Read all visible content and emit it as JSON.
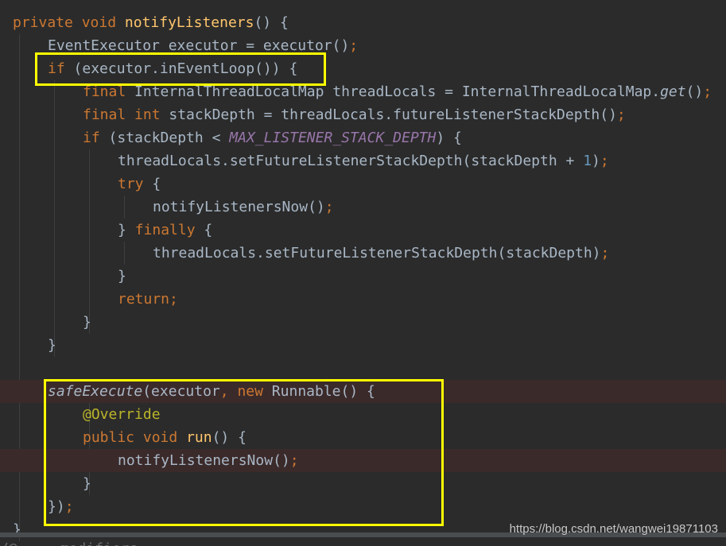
{
  "colors": {
    "background": "#2b2b2b",
    "keyword": "#cc7832",
    "method_declaration": "#ffc66d",
    "default_text": "#a9b7c6",
    "constant": "#9876aa",
    "number": "#6897bb",
    "annotation": "#bbb529",
    "highlight_box": "#ffff00",
    "error_line": "#3b2a2a"
  },
  "code_lines": [
    {
      "indent": 0,
      "tokens": [
        [
          "kw",
          "private"
        ],
        [
          "t",
          " "
        ],
        [
          "kw",
          "void"
        ],
        [
          "t",
          " "
        ],
        [
          "fn",
          "notifyListeners"
        ],
        [
          "t",
          "() {"
        ]
      ]
    },
    {
      "indent": 1,
      "tokens": [
        [
          "t",
          "EventExecutor executor = executor()"
        ],
        [
          "kw",
          ";"
        ]
      ]
    },
    {
      "indent": 1,
      "tokens": [
        [
          "kw",
          "if"
        ],
        [
          "t",
          " (executor.inEventLoop()) {"
        ]
      ]
    },
    {
      "indent": 2,
      "tokens": [
        [
          "kw",
          "final"
        ],
        [
          "t",
          " InternalThreadLocalMap threadLocals = InternalThreadLocalMap."
        ],
        [
          "it",
          "get"
        ],
        [
          "t",
          "()"
        ],
        [
          "kw",
          ";"
        ]
      ]
    },
    {
      "indent": 2,
      "tokens": [
        [
          "kw",
          "final"
        ],
        [
          "t",
          " "
        ],
        [
          "kw",
          "int"
        ],
        [
          "t",
          " stackDepth = threadLocals.futureListenerStackDepth()"
        ],
        [
          "kw",
          ";"
        ]
      ]
    },
    {
      "indent": 2,
      "tokens": [
        [
          "kw",
          "if"
        ],
        [
          "t",
          " (stackDepth < "
        ],
        [
          "const",
          "MAX_LISTENER_STACK_DEPTH"
        ],
        [
          "t",
          ") {"
        ]
      ]
    },
    {
      "indent": 3,
      "tokens": [
        [
          "t",
          "threadLocals.setFutureListenerStackDepth(stackDepth + "
        ],
        [
          "num",
          "1"
        ],
        [
          "t",
          ")"
        ],
        [
          "kw",
          ";"
        ]
      ]
    },
    {
      "indent": 3,
      "tokens": [
        [
          "kw",
          "try"
        ],
        [
          "t",
          " {"
        ]
      ]
    },
    {
      "indent": 4,
      "tokens": [
        [
          "t",
          "notifyListenersNow()"
        ],
        [
          "kw",
          ";"
        ]
      ]
    },
    {
      "indent": 3,
      "tokens": [
        [
          "t",
          "} "
        ],
        [
          "kw",
          "finally"
        ],
        [
          "t",
          " {"
        ]
      ]
    },
    {
      "indent": 4,
      "tokens": [
        [
          "t",
          "threadLocals.setFutureListenerStackDepth(stackDepth)"
        ],
        [
          "kw",
          ";"
        ]
      ]
    },
    {
      "indent": 3,
      "tokens": [
        [
          "t",
          "}"
        ]
      ]
    },
    {
      "indent": 3,
      "tokens": [
        [
          "kw",
          "return;"
        ]
      ]
    },
    {
      "indent": 2,
      "tokens": [
        [
          "t",
          "}"
        ]
      ]
    },
    {
      "indent": 1,
      "tokens": [
        [
          "t",
          "}"
        ]
      ]
    },
    {
      "indent": 0,
      "tokens": []
    },
    {
      "indent": 1,
      "highlight": true,
      "tokens": [
        [
          "it",
          "safeExecute"
        ],
        [
          "t",
          "(executor"
        ],
        [
          "kw",
          ","
        ],
        [
          "t",
          " "
        ],
        [
          "kw",
          "new"
        ],
        [
          "t",
          " Runnable() {"
        ]
      ]
    },
    {
      "indent": 2,
      "tokens": [
        [
          "ann",
          "@Override"
        ]
      ]
    },
    {
      "indent": 2,
      "tokens": [
        [
          "kw",
          "public"
        ],
        [
          "t",
          " "
        ],
        [
          "kw",
          "void"
        ],
        [
          "t",
          " "
        ],
        [
          "fn",
          "run"
        ],
        [
          "t",
          "() {"
        ]
      ]
    },
    {
      "indent": 3,
      "highlight": true,
      "tokens": [
        [
          "t",
          "notifyListenersNow()"
        ],
        [
          "kw",
          ";"
        ]
      ]
    },
    {
      "indent": 2,
      "tokens": [
        [
          "t",
          "}"
        ]
      ]
    },
    {
      "indent": 1,
      "tokens": [
        [
          "t",
          "})"
        ],
        [
          "kw",
          ";"
        ]
      ]
    },
    {
      "indent": 0,
      "tokens": [
        [
          "t",
          "}"
        ]
      ]
    }
  ],
  "bottom_fragment": "/@ ... modifiers ... ",
  "annotations": {
    "box1_label": "if (executor.inEventLoop()) {",
    "box2_label": "safeExecute(executor, new Runnable() { ... });"
  },
  "watermark": "https://blog.csdn.net/wangwei19871103"
}
